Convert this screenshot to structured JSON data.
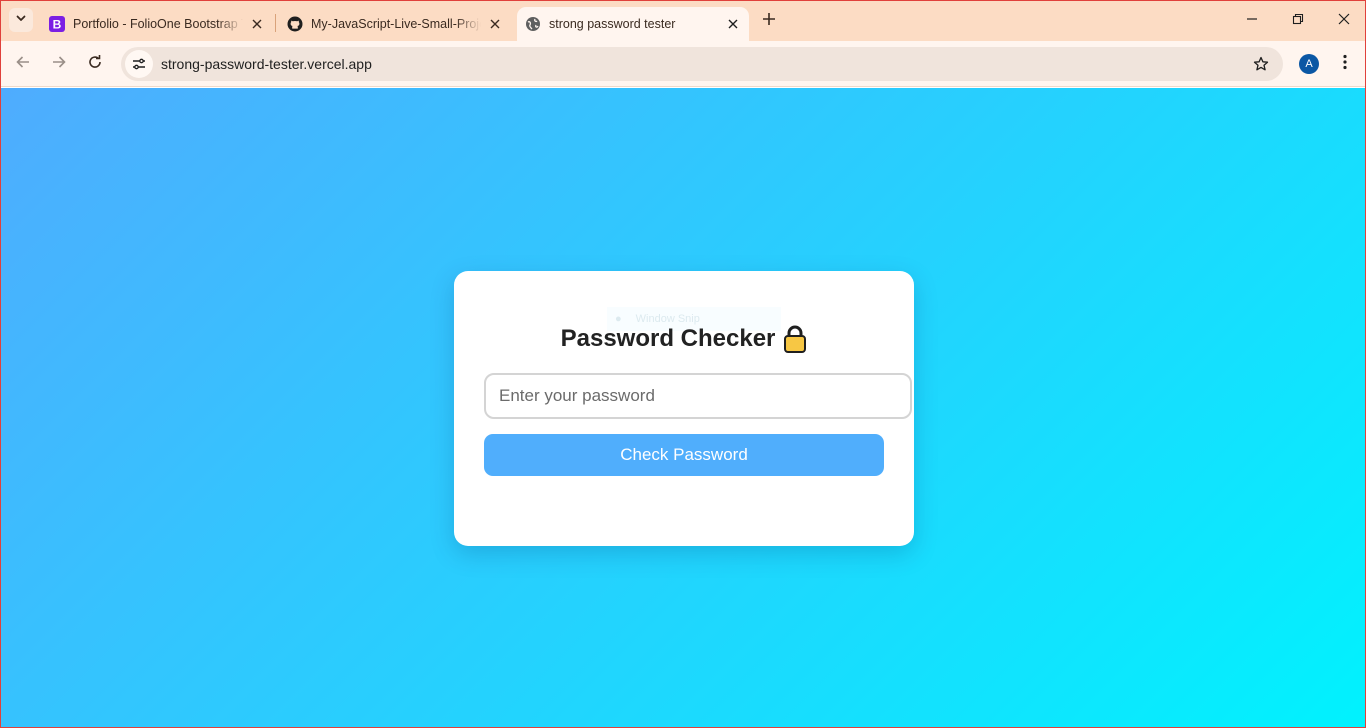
{
  "browser": {
    "tabs": [
      {
        "title": "Portfolio - FolioOne Bootstrap Template",
        "favicon": "bootstrap-icon",
        "active": false
      },
      {
        "title": "My-JavaScript-Live-Small-Projects",
        "favicon": "github-icon",
        "active": false
      },
      {
        "title": "strong password tester",
        "favicon": "globe-icon",
        "active": true
      }
    ],
    "url": "strong-password-tester.vercel.app",
    "profile_initial": "A"
  },
  "page": {
    "title": "Password Checker",
    "title_icon": "lock-icon",
    "input": {
      "placeholder": "Enter your password",
      "value": ""
    },
    "button_label": "Check Password",
    "overlay_text": "Window Snip"
  },
  "colors": {
    "gradient_start": "#4facfe",
    "gradient_end": "#00f2fe",
    "button": "#50aefc",
    "tabstrip": "#fcdcc4",
    "toolbar": "#fff5ef"
  }
}
